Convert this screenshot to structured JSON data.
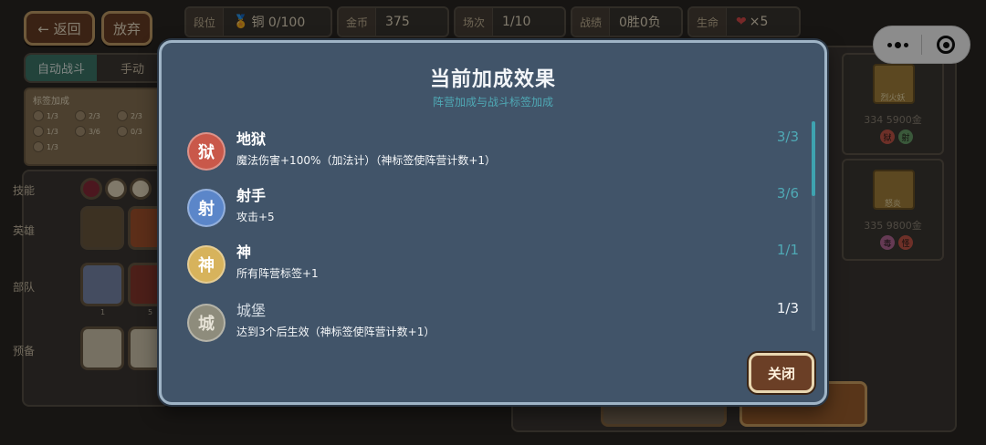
{
  "topbar": {
    "back_label": "← 返回",
    "abandon_label": "放弃",
    "rank_label": "段位",
    "rank_value": "铜 0/100",
    "gold_label": "金币",
    "gold_value": "375",
    "round_label": "场次",
    "round_value": "1/10",
    "record_label": "战绩",
    "record_value": "0胜0负",
    "life_label": "生命",
    "life_value": "×5"
  },
  "tabs": {
    "auto_label": "自动战斗",
    "manual_label": "手动"
  },
  "tags_panel": {
    "title": "标签加成",
    "items": [
      "1/3",
      "2/3",
      "2/3",
      "1/3",
      "3/6",
      "0/3",
      "1/3"
    ]
  },
  "left_panel": {
    "skill_label": "技能",
    "hero_label": "英雄",
    "troop_label": "部队",
    "reserve_label": "预备",
    "troop_levels": [
      "1",
      "5"
    ]
  },
  "shop": {
    "cards": [
      {
        "name": "烈火妖",
        "price": "334 5900金",
        "badges": [
          "狱",
          "射"
        ]
      },
      {
        "name": "怒炎",
        "price": "335 9800金",
        "badges": [
          "毒",
          "怪"
        ]
      }
    ]
  },
  "modal": {
    "title": "当前加成效果",
    "subtitle": "阵营加成与战斗标签加成",
    "effects": [
      {
        "glyph": "狱",
        "name": "地狱",
        "desc": "魔法伤害+100%（加法计）（神标签使阵营计数+1）",
        "count": "3/3",
        "active": true,
        "color": "#c9584a"
      },
      {
        "glyph": "射",
        "name": "射手",
        "desc": "攻击+5",
        "count": "3/6",
        "active": true,
        "color": "#5b86c9"
      },
      {
        "glyph": "神",
        "name": "神",
        "desc": "所有阵营标签+1",
        "count": "1/1",
        "active": true,
        "color": "#d7b35c"
      },
      {
        "glyph": "城",
        "name": "城堡",
        "desc": "达到3个后生效（神标签使阵营计数+1）",
        "count": "1/3",
        "active": false,
        "color": "#8e8c7c"
      }
    ],
    "close_label": "关闭"
  },
  "colors": {
    "modal_bg": "#415469",
    "subtitle": "#4fa9b5",
    "active_count": "#4fa9b5",
    "inactive_text": "#d3dbe3",
    "button_brown": "#6b3f26"
  }
}
